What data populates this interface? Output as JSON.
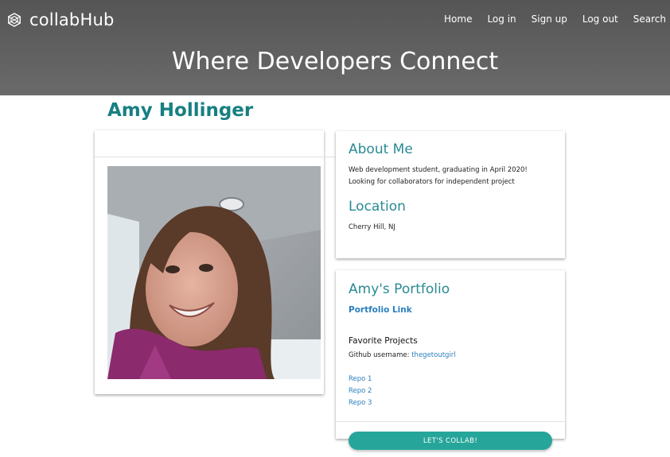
{
  "header": {
    "brand": "collabHub",
    "brand_icon": "network-globe-icon",
    "nav": [
      "Home",
      "Log in",
      "Sign up",
      "Log out",
      "Search"
    ],
    "hero_title": "Where Developers Connect",
    "background_color": "#5e5e5e"
  },
  "profile": {
    "name": "Amy Hollinger",
    "photo_alt": "profile-photo"
  },
  "about": {
    "heading": "About Me",
    "line1": "Web development student, graduating in April 2020!",
    "line2": "Looking for collaborators for independent project",
    "location_heading": "Location",
    "location": "Cherry Hill, NJ"
  },
  "portfolio": {
    "heading": "Amy's Portfolio",
    "link_label": "Portfolio Link",
    "favorites_heading": "Favorite Projects",
    "github_label": "Github username:",
    "github_username": "thegetoutgirl",
    "repos": [
      "Repo 1",
      "Repo 2",
      "Repo 3"
    ]
  },
  "collab_button": "LET'S COLLAB!",
  "colors": {
    "accent_teal": "#26a69a",
    "heading_teal": "#177f82",
    "link_blue": "#2b7fc0"
  }
}
